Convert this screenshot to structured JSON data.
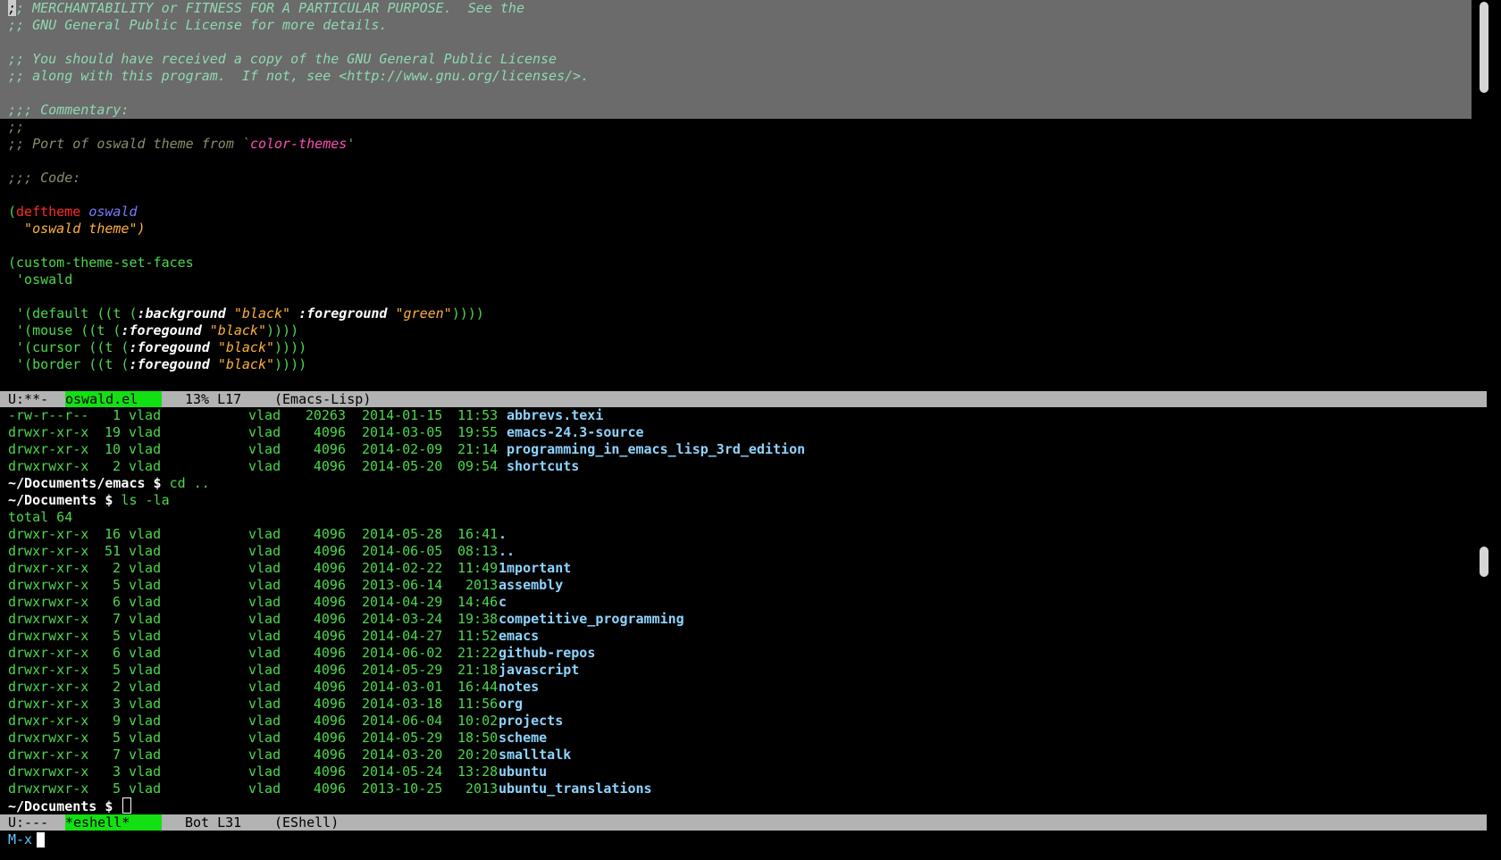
{
  "editor": {
    "highlighted_lines": [
      {
        "type": "comment",
        "text": ";; MERCHANTABILITY or FITNESS FOR A PARTICULAR PURPOSE.  See the"
      },
      {
        "type": "comment",
        "text": ";; GNU General Public License for more details."
      },
      {
        "type": "blank",
        "text": ""
      },
      {
        "type": "comment",
        "text": ";; You should have received a copy of the GNU General Public License"
      },
      {
        "type": "comment",
        "text": ";; along with this program.  If not, see <http://www.gnu.org/licenses/>."
      },
      {
        "type": "blank",
        "text": ""
      },
      {
        "type": "comment",
        "text": ";;; Commentary:"
      }
    ],
    "cursor_char": ";",
    "first_line_rest": "; MERCHANTABILITY or FITNESS FOR A PARTICULAR PURPOSE.  See the",
    "commentary_prefix": ";;",
    "port_comment_prefix": ";; Port of oswald theme from `",
    "port_comment_theme": "color-themes",
    "port_comment_suffix": "'",
    "code_comment": ";;; Code:",
    "deftheme_open": "(",
    "deftheme_kw": "deftheme",
    "deftheme_name": "oswald",
    "deftheme_doc": "  \"oswald theme\")",
    "custom_set": "(custom-theme-set-faces",
    "custom_quote": " 'oswald",
    "face_default_a": " '(default ((t (",
    "face_default_bg_kw": ":background",
    "face_default_bg_val": "\"black\"",
    "face_default_fg_kw": ":foreground",
    "face_default_fg_val": "\"green\"",
    "face_default_close": "))))",
    "face_mouse_a": " '(mouse ((t (",
    "face_cursor_a": " '(cursor ((t (",
    "face_border_a": " '(border ((t (",
    "foregound_kw": ":foregound",
    "black_val": "\"black\"",
    "close4": "))))"
  },
  "modeline_top": {
    "status": "U:**-",
    "buffer_name": "oswald.el",
    "position": "13% L17",
    "mode": "(Emacs-Lisp)"
  },
  "shell": {
    "rows_before": [
      {
        "perm": "-rw-r--r--",
        "links": "1",
        "owner": "vlad",
        "group": "vlad",
        "size": "20263",
        "date": "2014-01-15",
        "time": "11:53",
        "name": "abbrevs.texi"
      },
      {
        "perm": "drwxr-xr-x",
        "links": "19",
        "owner": "vlad",
        "group": "vlad",
        "size": "4096",
        "date": "2014-03-05",
        "time": "19:55",
        "name": "emacs-24.3-source"
      },
      {
        "perm": "drwxr-xr-x",
        "links": "10",
        "owner": "vlad",
        "group": "vlad",
        "size": "4096",
        "date": "2014-02-09",
        "time": "21:14",
        "name": "programming_in_emacs_lisp_3rd_edition"
      },
      {
        "perm": "drwxrwxr-x",
        "links": "2",
        "owner": "vlad",
        "group": "vlad",
        "size": "4096",
        "date": "2014-05-20",
        "time": "09:54",
        "name": "shortcuts"
      }
    ],
    "prompt1": "~/Documents/emacs $",
    "cmd1": " cd ..",
    "prompt2": "~/Documents $",
    "cmd2": " ls -la",
    "total": "total 64",
    "rows_after": [
      {
        "perm": "drwxr-xr-x",
        "links": "16",
        "owner": "vlad",
        "group": "vlad",
        "size": "4096",
        "date": "2014-05-28",
        "time": "16:41",
        "name": "."
      },
      {
        "perm": "drwxr-xr-x",
        "links": "51",
        "owner": "vlad",
        "group": "vlad",
        "size": "4096",
        "date": "2014-06-05",
        "time": "08:13",
        "name": ".."
      },
      {
        "perm": "drwxr-xr-x",
        "links": "2",
        "owner": "vlad",
        "group": "vlad",
        "size": "4096",
        "date": "2014-02-22",
        "time": "11:49",
        "name": "1mportant"
      },
      {
        "perm": "drwxrwxr-x",
        "links": "5",
        "owner": "vlad",
        "group": "vlad",
        "size": "4096",
        "date": "2013-06-14",
        "time": " 2013",
        "name": "assembly"
      },
      {
        "perm": "drwxrwxr-x",
        "links": "6",
        "owner": "vlad",
        "group": "vlad",
        "size": "4096",
        "date": "2014-04-29",
        "time": "14:46",
        "name": "c"
      },
      {
        "perm": "drwxrwxr-x",
        "links": "7",
        "owner": "vlad",
        "group": "vlad",
        "size": "4096",
        "date": "2014-03-24",
        "time": "19:38",
        "name": "competitive_programming"
      },
      {
        "perm": "drwxrwxr-x",
        "links": "5",
        "owner": "vlad",
        "group": "vlad",
        "size": "4096",
        "date": "2014-04-27",
        "time": "11:52",
        "name": "emacs"
      },
      {
        "perm": "drwxr-xr-x",
        "links": "6",
        "owner": "vlad",
        "group": "vlad",
        "size": "4096",
        "date": "2014-06-02",
        "time": "21:22",
        "name": "github-repos"
      },
      {
        "perm": "drwxr-xr-x",
        "links": "5",
        "owner": "vlad",
        "group": "vlad",
        "size": "4096",
        "date": "2014-05-29",
        "time": "21:18",
        "name": "javascript"
      },
      {
        "perm": "drwxr-xr-x",
        "links": "2",
        "owner": "vlad",
        "group": "vlad",
        "size": "4096",
        "date": "2014-03-01",
        "time": "16:44",
        "name": "notes"
      },
      {
        "perm": "drwxr-xr-x",
        "links": "3",
        "owner": "vlad",
        "group": "vlad",
        "size": "4096",
        "date": "2014-03-18",
        "time": "11:56",
        "name": "org"
      },
      {
        "perm": "drwxr-xr-x",
        "links": "9",
        "owner": "vlad",
        "group": "vlad",
        "size": "4096",
        "date": "2014-06-04",
        "time": "10:02",
        "name": "projects"
      },
      {
        "perm": "drwxrwxr-x",
        "links": "5",
        "owner": "vlad",
        "group": "vlad",
        "size": "4096",
        "date": "2014-05-29",
        "time": "18:50",
        "name": "scheme"
      },
      {
        "perm": "drwxr-xr-x",
        "links": "7",
        "owner": "vlad",
        "group": "vlad",
        "size": "4096",
        "date": "2014-03-20",
        "time": "20:20",
        "name": "smalltalk"
      },
      {
        "perm": "drwxrwxr-x",
        "links": "3",
        "owner": "vlad",
        "group": "vlad",
        "size": "4096",
        "date": "2014-05-24",
        "time": "13:28",
        "name": "ubuntu"
      },
      {
        "perm": "drwxrwxr-x",
        "links": "5",
        "owner": "vlad",
        "group": "vlad",
        "size": "4096",
        "date": "2013-10-25",
        "time": " 2013",
        "name": "ubuntu_translations"
      }
    ],
    "prompt3": "~/Documents $"
  },
  "modeline_bottom": {
    "status": "U:---",
    "buffer_name": "*eshell*",
    "position": "Bot L31",
    "mode": "(EShell)"
  },
  "minibuffer": {
    "prompt": "M-x"
  },
  "colors": {
    "foreground": "#4cd84c",
    "comment": "#8fd9b0",
    "region": "#6b6b6b",
    "modeline": "#b3b3b3",
    "buffer_name_bg": "#12e012",
    "directory": "#8fd4ff",
    "keyword": "#ff2a2a",
    "string": "#ffb13b"
  }
}
